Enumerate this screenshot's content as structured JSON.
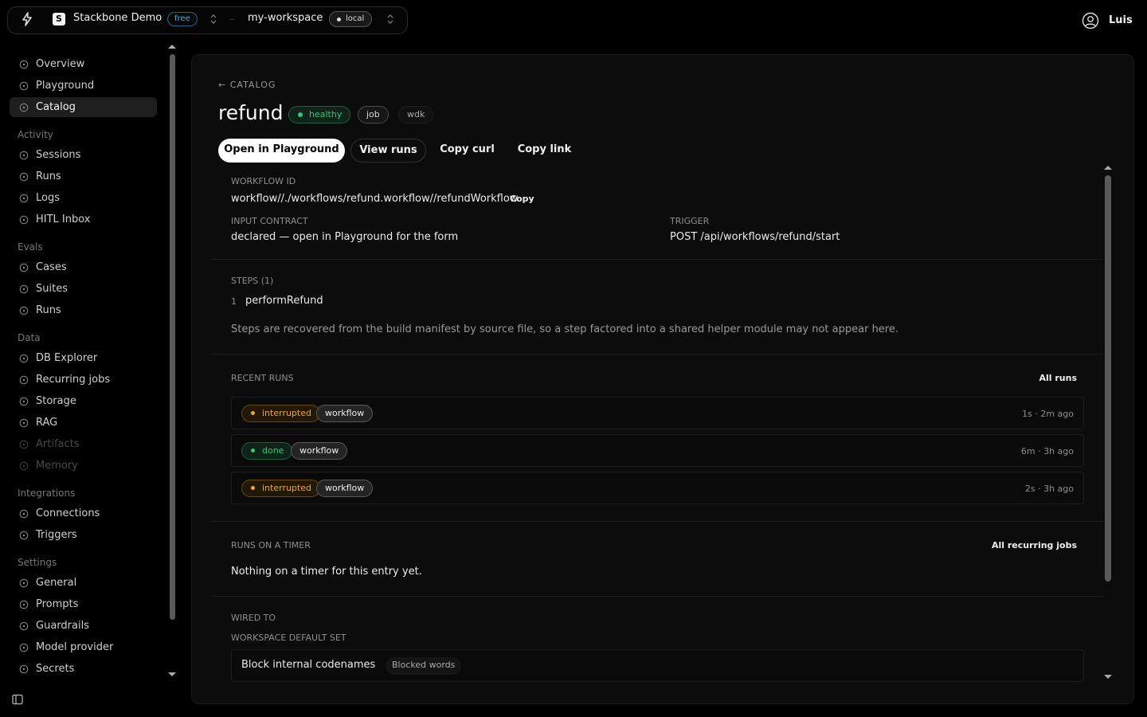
{
  "topbar": {
    "org_name": "Stackbone Demo",
    "org_logo": "S",
    "plan_badge": "free",
    "workspace": "my-workspace",
    "env_badge": "local",
    "user": "Luis"
  },
  "sidebar": {
    "items_top": [
      {
        "label": "Overview",
        "icon": "info-circle-icon"
      },
      {
        "label": "Playground",
        "icon": "play-circle-icon"
      },
      {
        "label": "Catalog",
        "icon": "users-icon",
        "active": true
      }
    ],
    "groups": [
      {
        "title": "Activity",
        "items": [
          {
            "label": "Sessions",
            "icon": "list-icon"
          },
          {
            "label": "Runs",
            "icon": "check-circle-icon"
          },
          {
            "label": "Logs",
            "icon": "document-icon"
          },
          {
            "label": "HITL Inbox",
            "icon": "inbox-icon"
          }
        ]
      },
      {
        "title": "Evals",
        "items": [
          {
            "label": "Cases",
            "icon": "checklist-icon"
          },
          {
            "label": "Suites",
            "icon": "layers-icon"
          },
          {
            "label": "Runs",
            "icon": "chart-icon"
          }
        ]
      },
      {
        "title": "Data",
        "items": [
          {
            "label": "DB Explorer",
            "icon": "database-icon"
          },
          {
            "label": "Recurring jobs",
            "icon": "clock-icon"
          },
          {
            "label": "Storage",
            "icon": "storage-icon"
          },
          {
            "label": "RAG",
            "icon": "book-icon"
          },
          {
            "label": "Artifacts",
            "icon": "artifact-icon",
            "disabled": true
          },
          {
            "label": "Memory",
            "icon": "memory-icon",
            "disabled": true
          }
        ]
      },
      {
        "title": "Integrations",
        "items": [
          {
            "label": "Connections",
            "icon": "plug-icon"
          },
          {
            "label": "Triggers",
            "icon": "zap-icon"
          }
        ]
      },
      {
        "title": "Settings",
        "items": [
          {
            "label": "General",
            "icon": "gear-icon"
          },
          {
            "label": "Prompts",
            "icon": "message-icon"
          },
          {
            "label": "Guardrails",
            "icon": "shield-icon"
          },
          {
            "label": "Model provider",
            "icon": "cube-icon"
          },
          {
            "label": "Secrets",
            "icon": "key-icon"
          }
        ]
      }
    ]
  },
  "entry": {
    "back_label": "← CATALOG",
    "title": "refund",
    "status": "healthy",
    "kind": "job",
    "runtime": "wdk",
    "actions": {
      "open_playground": "Open in Playground",
      "view_runs": "View runs",
      "copy_curl": "Copy curl",
      "copy_link": "Copy link"
    }
  },
  "details": {
    "workflow_id_label": "WORKFLOW ID",
    "workflow_id": "workflow//./workflows/refund.workflow//refundWorkflow",
    "copy_label": "Copy",
    "input_contract_label": "INPUT CONTRACT",
    "input_contract": "declared — open in Playground for the form",
    "trigger_label": "TRIGGER",
    "trigger": "POST /api/workflows/refund/start"
  },
  "steps": {
    "label": "STEPS (1)",
    "items": [
      {
        "num": "1",
        "name": "performRefund"
      }
    ],
    "note": "Steps are recovered from the build manifest by source file, so a step factored into a shared helper module may not appear here."
  },
  "recent_runs": {
    "label": "RECENT RUNS",
    "all_link": "All runs",
    "runs": [
      {
        "status": "interrupted",
        "kind": "workflow",
        "meta": "1s · 2m ago"
      },
      {
        "status": "done",
        "kind": "workflow",
        "meta": "6m · 3h ago"
      },
      {
        "status": "interrupted",
        "kind": "workflow",
        "meta": "2s · 3h ago"
      }
    ]
  },
  "timers": {
    "label": "RUNS ON A TIMER",
    "all_link": "All recurring jobs",
    "empty": "Nothing on a timer for this entry yet."
  },
  "wired": {
    "label": "WIRED TO",
    "set_label": "WORKSPACE DEFAULT SET",
    "guardrail_name": "Block internal codenames",
    "guardrail_tag": "Blocked words"
  },
  "colors": {
    "healthy": "#39c57a",
    "interrupted": "#e8a93a",
    "free_badge": "#3fb6e6"
  }
}
